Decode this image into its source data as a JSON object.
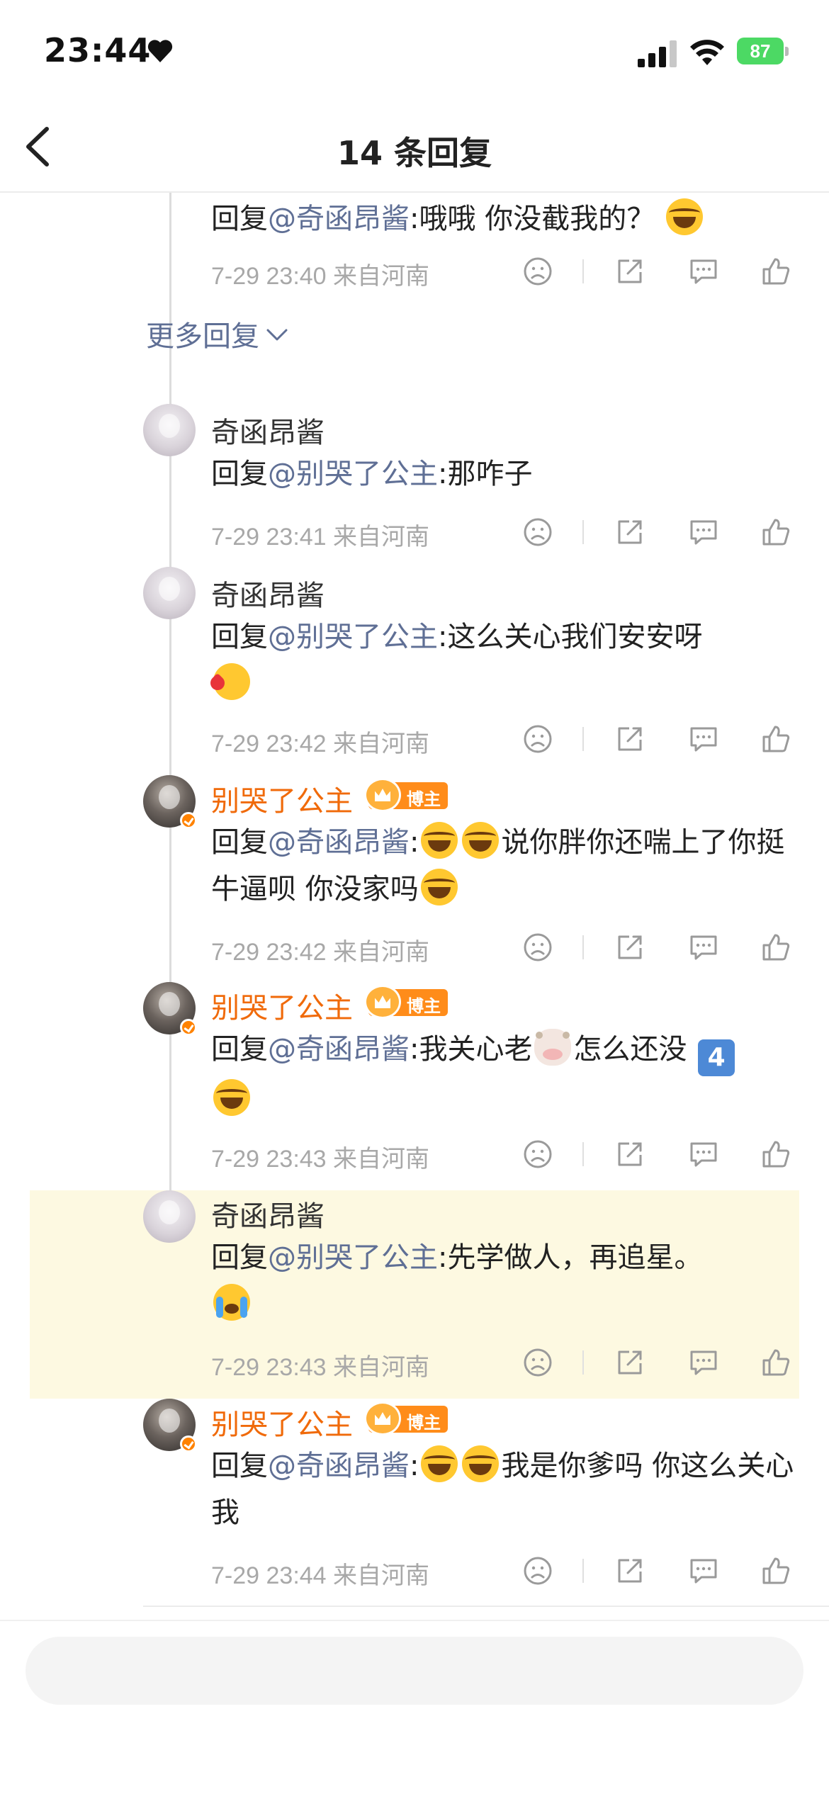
{
  "status_bar": {
    "time": "23:44",
    "battery": "87"
  },
  "nav": {
    "title": "14 条回复"
  },
  "partial_reply": {
    "prefix": "回复",
    "mention": "@奇函昂酱",
    "text": ":哦哦 你没截我的？",
    "meta": "7-29 23:40 来自河南"
  },
  "more_replies": "更多回复",
  "replies": [
    {
      "user": "奇函昂酱",
      "prefix": "回复",
      "mention": "@别哭了公主",
      "text": ":那咋子",
      "meta": "7-29 23:41 来自河南"
    },
    {
      "user": "奇函昂酱",
      "prefix": "回复",
      "mention": "@别哭了公主",
      "text": ":这么关心我们安安呀",
      "meta": "7-29 23:42 来自河南"
    },
    {
      "user": "别哭了公主",
      "badge": "博主",
      "prefix": "回复",
      "mention": "@奇函昂酱",
      "text1": ":",
      "text2": "说你胖你还喘上了你挺牛逼呗 你没家吗",
      "meta": "7-29 23:42 来自河南"
    },
    {
      "user": "别哭了公主",
      "badge": "博主",
      "prefix": "回复",
      "mention": "@奇函昂酱",
      "text1": ":我关心老",
      "text2": "怎么还没",
      "keycap": "4",
      "meta": "7-29 23:43 来自河南"
    },
    {
      "user": "奇函昂酱",
      "prefix": "回复",
      "mention": "@别哭了公主",
      "text": ":先学做人，再追星。",
      "meta": "7-29 23:43 来自河南"
    },
    {
      "user": "别哭了公主",
      "badge": "博主",
      "prefix": "回复",
      "mention": "@奇函昂酱",
      "text1": ":",
      "text2": "我是你爹吗 你这么关心我",
      "meta": "7-29 23:44 来自河南"
    }
  ],
  "colors": {
    "mention": "#5f6f95",
    "blogger_name": "#f06a0a",
    "badge": "#ff8c1a",
    "highlight": "#fdf9e1"
  },
  "icons": [
    "dislike-icon",
    "share-icon",
    "comment-icon",
    "like-icon",
    "back-arrow-icon",
    "chevron-down-icon"
  ]
}
